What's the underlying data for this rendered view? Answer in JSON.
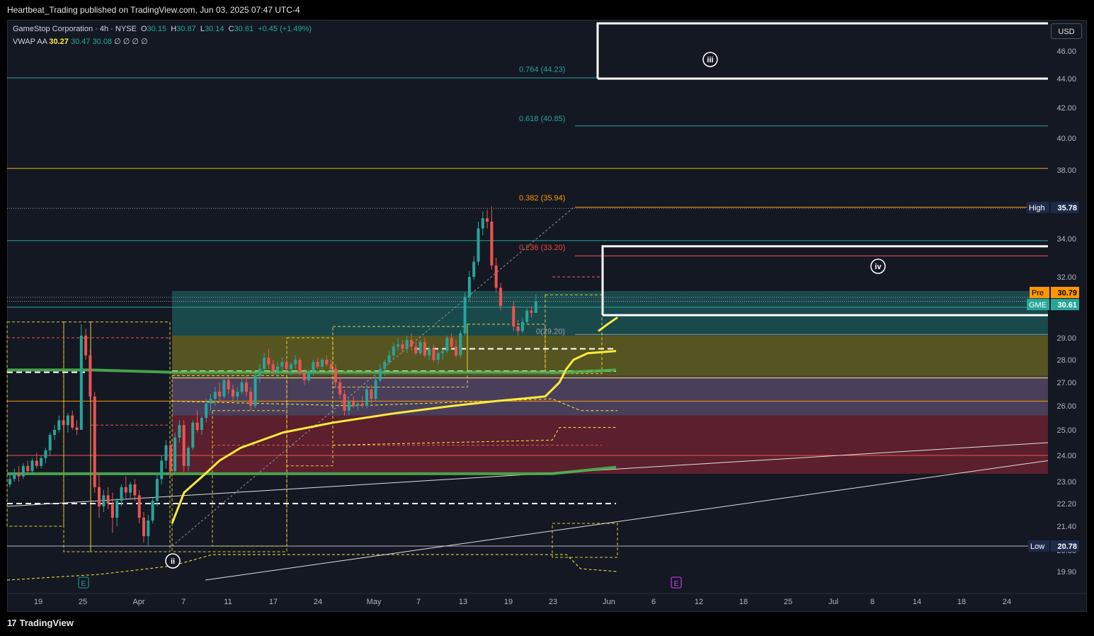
{
  "caption": "Heartbeat_Trading published on TradingView.com, Jun 03, 2025 07:47 UTC-4",
  "legend": {
    "symbol": "GameStop Corporation · 4h · NYSE",
    "o_label": "O",
    "o": "30.15",
    "h_label": "H",
    "h": "30.87",
    "l_label": "L",
    "l": "30.14",
    "c_label": "C",
    "c": "30.61",
    "change": "+0.45 (+1.49%)",
    "vwap_name": "VWAP AA",
    "vwap_v1": "30.27",
    "vwap_v2": "30.47",
    "vwap_v3": "30.08",
    "vwap_rest": "∅ ∅ ∅ ∅"
  },
  "currency_button": "USD",
  "brand": "TradingView",
  "colors": {
    "background": "#141823",
    "up": "#26a69a",
    "down": "#ef5350",
    "vwap": "#ffeb3b",
    "ma": "#4caf50",
    "fib_teal": "#26a69a",
    "fib_orange": "#ff9800",
    "fib_red": "#f44336"
  },
  "chart_data": {
    "type": "candlestick",
    "ylim": [
      19.9,
      47.0
    ],
    "y_ticks": [
      "46.00",
      "44.00",
      "42.00",
      "40.00",
      "38.00",
      "36.00",
      "34.00",
      "32.00",
      "31.00",
      "29.00",
      "28.00",
      "27.00",
      "26.00",
      "25.00",
      "24.00",
      "23.00",
      "22.20",
      "21.40",
      "20.80",
      "19.90"
    ],
    "x_ticks": [
      "19",
      "25",
      "Apr",
      "7",
      "11",
      "17",
      "24",
      "May",
      "7",
      "13",
      "19",
      "23",
      "Jun",
      "6",
      "12",
      "18",
      "25",
      "Jul",
      "8",
      "14",
      "18",
      "24"
    ],
    "price_tags": [
      {
        "name": "High",
        "value": "35.78",
        "color": "#1e3a6e"
      },
      {
        "name": "Pre",
        "value": "30.79",
        "color": "#ff9800"
      },
      {
        "name": "GME",
        "value": "30.61",
        "color": "#26a69a"
      },
      {
        "name": "Low",
        "value": "20.78",
        "color": "#1e3a6e"
      }
    ],
    "fib_levels": [
      {
        "label": "0.764 (44.23)",
        "value": 44.23,
        "color": "#26a69a"
      },
      {
        "label": "0.618 (40.85)",
        "value": 40.85,
        "color": "#26a69a"
      },
      {
        "label": "0.382 (35.94)",
        "value": 35.94,
        "color": "#ff9800"
      },
      {
        "label": "0.236 (33.20)",
        "value": 33.2,
        "color": "#f44336"
      },
      {
        "label": "0(29.20)",
        "value": 29.2,
        "color": "#9e9e9e"
      }
    ],
    "wave_labels": [
      "ii",
      "iii",
      "iv"
    ],
    "earnings_markers": [
      "E",
      "E"
    ],
    "candles": [
      {
        "o": 22.9,
        "h": 23.3,
        "l": 22.8,
        "c": 23.1
      },
      {
        "o": 23.1,
        "h": 23.5,
        "l": 23.0,
        "c": 23.3
      },
      {
        "o": 23.3,
        "h": 23.6,
        "l": 23.0,
        "c": 23.2
      },
      {
        "o": 23.2,
        "h": 23.7,
        "l": 23.1,
        "c": 23.6
      },
      {
        "o": 23.6,
        "h": 23.8,
        "l": 23.3,
        "c": 23.4
      },
      {
        "o": 23.4,
        "h": 23.9,
        "l": 23.3,
        "c": 23.8
      },
      {
        "o": 23.8,
        "h": 24.1,
        "l": 23.5,
        "c": 23.6
      },
      {
        "o": 23.6,
        "h": 24.0,
        "l": 23.5,
        "c": 23.9
      },
      {
        "o": 23.9,
        "h": 24.3,
        "l": 23.7,
        "c": 24.2
      },
      {
        "o": 24.2,
        "h": 24.9,
        "l": 24.0,
        "c": 24.8
      },
      {
        "o": 24.8,
        "h": 25.2,
        "l": 24.6,
        "c": 25.0
      },
      {
        "o": 25.0,
        "h": 25.6,
        "l": 24.9,
        "c": 25.4
      },
      {
        "o": 25.4,
        "h": 25.6,
        "l": 25.0,
        "c": 25.2
      },
      {
        "o": 25.2,
        "h": 25.7,
        "l": 24.9,
        "c": 25.6
      },
      {
        "o": 25.6,
        "h": 25.8,
        "l": 25.0,
        "c": 25.1
      },
      {
        "o": 25.1,
        "h": 25.4,
        "l": 24.8,
        "c": 25.0
      },
      {
        "o": 25.0,
        "h": 29.6,
        "l": 25.0,
        "c": 29.1
      },
      {
        "o": 29.1,
        "h": 29.4,
        "l": 28.0,
        "c": 28.2
      },
      {
        "o": 28.2,
        "h": 28.5,
        "l": 26.2,
        "c": 26.4
      },
      {
        "o": 26.4,
        "h": 26.6,
        "l": 22.6,
        "c": 22.8
      },
      {
        "o": 22.8,
        "h": 23.3,
        "l": 21.7,
        "c": 22.1
      },
      {
        "o": 22.1,
        "h": 22.7,
        "l": 21.9,
        "c": 22.5
      },
      {
        "o": 22.5,
        "h": 22.8,
        "l": 22.0,
        "c": 22.2
      },
      {
        "o": 22.2,
        "h": 22.6,
        "l": 21.2,
        "c": 21.7
      },
      {
        "o": 21.7,
        "h": 22.4,
        "l": 21.4,
        "c": 22.3
      },
      {
        "o": 22.3,
        "h": 22.9,
        "l": 22.1,
        "c": 22.8
      },
      {
        "o": 22.8,
        "h": 23.2,
        "l": 22.4,
        "c": 22.6
      },
      {
        "o": 22.6,
        "h": 23.0,
        "l": 22.4,
        "c": 22.9
      },
      {
        "o": 22.9,
        "h": 23.1,
        "l": 22.3,
        "c": 22.5
      },
      {
        "o": 22.5,
        "h": 22.7,
        "l": 21.5,
        "c": 21.7
      },
      {
        "o": 21.7,
        "h": 21.9,
        "l": 20.9,
        "c": 21.1
      },
      {
        "o": 21.1,
        "h": 21.8,
        "l": 20.8,
        "c": 21.6
      },
      {
        "o": 21.6,
        "h": 22.4,
        "l": 21.5,
        "c": 22.3
      },
      {
        "o": 22.3,
        "h": 23.3,
        "l": 22.1,
        "c": 23.1
      },
      {
        "o": 23.1,
        "h": 24.0,
        "l": 22.9,
        "c": 23.8
      },
      {
        "o": 23.8,
        "h": 24.6,
        "l": 23.5,
        "c": 24.4
      },
      {
        "o": 24.4,
        "h": 24.6,
        "l": 23.2,
        "c": 23.4
      },
      {
        "o": 23.4,
        "h": 24.9,
        "l": 23.3,
        "c": 24.7
      },
      {
        "o": 24.7,
        "h": 25.4,
        "l": 24.5,
        "c": 25.2
      },
      {
        "o": 25.2,
        "h": 25.4,
        "l": 23.3,
        "c": 23.6
      },
      {
        "o": 23.6,
        "h": 24.4,
        "l": 23.4,
        "c": 24.3
      },
      {
        "o": 24.3,
        "h": 25.4,
        "l": 24.2,
        "c": 25.3
      },
      {
        "o": 25.3,
        "h": 25.8,
        "l": 24.9,
        "c": 25.0
      },
      {
        "o": 25.0,
        "h": 25.6,
        "l": 24.8,
        "c": 25.5
      },
      {
        "o": 25.5,
        "h": 26.3,
        "l": 25.3,
        "c": 26.1
      },
      {
        "o": 26.1,
        "h": 26.5,
        "l": 25.8,
        "c": 26.3
      },
      {
        "o": 26.3,
        "h": 26.8,
        "l": 26.0,
        "c": 26.6
      },
      {
        "o": 26.6,
        "h": 27.0,
        "l": 26.2,
        "c": 26.4
      },
      {
        "o": 26.4,
        "h": 27.2,
        "l": 26.3,
        "c": 27.1
      },
      {
        "o": 27.1,
        "h": 27.3,
        "l": 26.5,
        "c": 26.7
      },
      {
        "o": 26.7,
        "h": 26.9,
        "l": 26.2,
        "c": 26.4
      },
      {
        "o": 26.4,
        "h": 26.8,
        "l": 26.1,
        "c": 26.6
      },
      {
        "o": 26.6,
        "h": 27.2,
        "l": 26.5,
        "c": 27.0
      },
      {
        "o": 27.0,
        "h": 27.3,
        "l": 26.4,
        "c": 26.6
      },
      {
        "o": 26.6,
        "h": 26.8,
        "l": 25.8,
        "c": 26.0
      },
      {
        "o": 26.0,
        "h": 27.4,
        "l": 25.9,
        "c": 27.3
      },
      {
        "o": 27.3,
        "h": 27.8,
        "l": 27.0,
        "c": 27.6
      },
      {
        "o": 27.6,
        "h": 28.3,
        "l": 27.4,
        "c": 28.1
      },
      {
        "o": 28.1,
        "h": 28.5,
        "l": 27.6,
        "c": 27.8
      },
      {
        "o": 27.8,
        "h": 28.0,
        "l": 27.3,
        "c": 27.5
      },
      {
        "o": 27.5,
        "h": 27.9,
        "l": 27.2,
        "c": 27.7
      },
      {
        "o": 27.7,
        "h": 28.1,
        "l": 27.5,
        "c": 27.9
      },
      {
        "o": 27.9,
        "h": 28.0,
        "l": 27.5,
        "c": 27.6
      },
      {
        "o": 27.6,
        "h": 27.9,
        "l": 27.3,
        "c": 27.8
      },
      {
        "o": 27.8,
        "h": 28.2,
        "l": 27.6,
        "c": 28.0
      },
      {
        "o": 28.0,
        "h": 28.1,
        "l": 27.3,
        "c": 27.4
      },
      {
        "o": 27.4,
        "h": 27.6,
        "l": 26.9,
        "c": 27.1
      },
      {
        "o": 27.1,
        "h": 27.6,
        "l": 27.0,
        "c": 27.5
      },
      {
        "o": 27.5,
        "h": 28.0,
        "l": 27.3,
        "c": 27.9
      },
      {
        "o": 27.9,
        "h": 28.1,
        "l": 27.6,
        "c": 27.7
      },
      {
        "o": 27.7,
        "h": 28.1,
        "l": 27.6,
        "c": 28.0
      },
      {
        "o": 28.0,
        "h": 28.2,
        "l": 27.7,
        "c": 27.8
      },
      {
        "o": 27.8,
        "h": 28.0,
        "l": 27.4,
        "c": 27.6
      },
      {
        "o": 27.6,
        "h": 27.8,
        "l": 26.8,
        "c": 27.0
      },
      {
        "o": 27.0,
        "h": 27.2,
        "l": 26.3,
        "c": 26.5
      },
      {
        "o": 26.5,
        "h": 26.7,
        "l": 25.6,
        "c": 25.8
      },
      {
        "o": 25.8,
        "h": 26.3,
        "l": 25.6,
        "c": 26.2
      },
      {
        "o": 26.2,
        "h": 26.4,
        "l": 25.9,
        "c": 26.0
      },
      {
        "o": 26.0,
        "h": 26.2,
        "l": 25.8,
        "c": 26.1
      },
      {
        "o": 26.1,
        "h": 26.4,
        "l": 25.9,
        "c": 26.0
      },
      {
        "o": 26.0,
        "h": 26.9,
        "l": 25.9,
        "c": 26.7
      },
      {
        "o": 26.7,
        "h": 26.9,
        "l": 26.1,
        "c": 26.3
      },
      {
        "o": 26.3,
        "h": 27.3,
        "l": 26.2,
        "c": 27.1
      },
      {
        "o": 27.1,
        "h": 27.8,
        "l": 27.0,
        "c": 27.6
      },
      {
        "o": 27.6,
        "h": 28.0,
        "l": 27.3,
        "c": 27.9
      },
      {
        "o": 27.9,
        "h": 28.4,
        "l": 27.8,
        "c": 28.2
      },
      {
        "o": 28.2,
        "h": 28.8,
        "l": 28.0,
        "c": 28.6
      },
      {
        "o": 28.6,
        "h": 29.0,
        "l": 28.4,
        "c": 28.7
      },
      {
        "o": 28.7,
        "h": 28.9,
        "l": 28.3,
        "c": 28.5
      },
      {
        "o": 28.5,
        "h": 29.1,
        "l": 28.3,
        "c": 28.9
      },
      {
        "o": 28.9,
        "h": 29.2,
        "l": 28.4,
        "c": 28.6
      },
      {
        "o": 28.6,
        "h": 28.8,
        "l": 28.2,
        "c": 28.3
      },
      {
        "o": 28.3,
        "h": 28.9,
        "l": 28.2,
        "c": 28.8
      },
      {
        "o": 28.8,
        "h": 29.0,
        "l": 28.1,
        "c": 28.2
      },
      {
        "o": 28.2,
        "h": 28.6,
        "l": 28.0,
        "c": 28.5
      },
      {
        "o": 28.5,
        "h": 28.7,
        "l": 27.9,
        "c": 28.0
      },
      {
        "o": 28.0,
        "h": 28.4,
        "l": 27.8,
        "c": 28.3
      },
      {
        "o": 28.3,
        "h": 28.5,
        "l": 28.0,
        "c": 28.4
      },
      {
        "o": 28.4,
        "h": 29.1,
        "l": 28.3,
        "c": 29.0
      },
      {
        "o": 29.0,
        "h": 29.2,
        "l": 28.5,
        "c": 28.6
      },
      {
        "o": 28.6,
        "h": 28.9,
        "l": 28.1,
        "c": 28.2
      },
      {
        "o": 28.2,
        "h": 29.3,
        "l": 28.1,
        "c": 29.2
      },
      {
        "o": 29.2,
        "h": 31.0,
        "l": 29.1,
        "c": 30.8
      },
      {
        "o": 30.8,
        "h": 32.3,
        "l": 30.6,
        "c": 32.0
      },
      {
        "o": 32.0,
        "h": 33.1,
        "l": 31.8,
        "c": 32.8
      },
      {
        "o": 32.8,
        "h": 35.0,
        "l": 32.6,
        "c": 34.6
      },
      {
        "o": 34.6,
        "h": 35.6,
        "l": 34.2,
        "c": 35.2
      },
      {
        "o": 35.2,
        "h": 35.7,
        "l": 34.6,
        "c": 35.0
      },
      {
        "o": 35.0,
        "h": 35.9,
        "l": 32.4,
        "c": 32.6
      },
      {
        "o": 32.6,
        "h": 33.0,
        "l": 31.0,
        "c": 31.3
      },
      {
        "o": 31.3,
        "h": 31.6,
        "l": 30.2,
        "c": 30.4
      },
      {
        "o": 30.4,
        "h": 30.6,
        "l": 29.3,
        "c": 29.5
      },
      {
        "o": 29.5,
        "h": 29.8,
        "l": 29.1,
        "c": 29.3
      },
      {
        "o": 29.3,
        "h": 29.9,
        "l": 29.2,
        "c": 29.7
      },
      {
        "o": 29.7,
        "h": 30.3,
        "l": 29.6,
        "c": 30.2
      },
      {
        "o": 30.2,
        "h": 30.4,
        "l": 29.9,
        "c": 30.1
      },
      {
        "o": 30.1,
        "h": 30.9,
        "l": 30.1,
        "c": 30.6
      }
    ]
  }
}
